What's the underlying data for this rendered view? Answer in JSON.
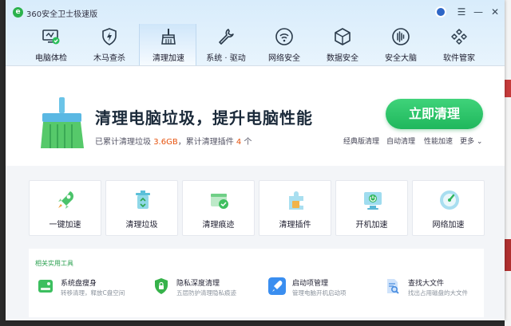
{
  "app": {
    "title": "360安全卫士极速版"
  },
  "window_controls": {
    "menu": "☰",
    "minimize": "—",
    "close": "✕"
  },
  "nav": [
    {
      "label": "电脑体检",
      "icon": "monitor-check-icon",
      "active": false
    },
    {
      "label": "木马查杀",
      "icon": "shield-bolt-icon",
      "active": false
    },
    {
      "label": "清理加速",
      "icon": "broom-icon",
      "active": true
    },
    {
      "label": "系统 · 驱动",
      "icon": "wrench-icon",
      "active": false
    },
    {
      "label": "网络安全",
      "icon": "wifi-icon",
      "active": false
    },
    {
      "label": "数据安全",
      "icon": "cube-icon",
      "active": false
    },
    {
      "label": "安全大脑",
      "icon": "brain-icon",
      "active": false
    },
    {
      "label": "软件管家",
      "icon": "apps-icon",
      "active": false
    }
  ],
  "hero": {
    "headline": "清理电脑垃圾，提升电脑性能",
    "sub_prefix": "已累计清理垃圾",
    "cleaned_size": "3.6GB",
    "sub_middle": "，累计清理插件",
    "plugin_count": "4",
    "sub_suffix": "个",
    "clean_button": "立即清理",
    "links": [
      "经典版清理",
      "自动清理",
      "性能加速",
      "更多"
    ]
  },
  "tiles": [
    {
      "label": "一键加速",
      "icon": "rocket-icon"
    },
    {
      "label": "清理垃圾",
      "icon": "trash-icon"
    },
    {
      "label": "清理痕迹",
      "icon": "trace-icon"
    },
    {
      "label": "清理插件",
      "icon": "plugin-icon"
    },
    {
      "label": "开机加速",
      "icon": "power-icon"
    },
    {
      "label": "网络加速",
      "icon": "speedometer-icon"
    }
  ],
  "tools": {
    "title": "相关实用工具",
    "items": [
      {
        "title": "系统盘瘦身",
        "desc": "转移清理，释放C盘空间",
        "icon": "disk-icon",
        "color": "#3cbf5f"
      },
      {
        "title": "隐私深度清理",
        "desc": "五层防护清理隐私痕迹",
        "icon": "privacy-shield-icon",
        "color": "#36b24a"
      },
      {
        "title": "启动项管理",
        "desc": "管理电脑开机启动项",
        "icon": "startup-rocket-icon",
        "color": "#3a8ef0"
      },
      {
        "title": "查找大文件",
        "desc": "找出占用磁盘的大文件",
        "icon": "file-search-icon",
        "color": "#4a8ee0"
      }
    ]
  },
  "colors": {
    "accent_green": "#1fb75c",
    "highlight_orange": "#e6520d",
    "tools_title_green": "#2aa04f"
  }
}
